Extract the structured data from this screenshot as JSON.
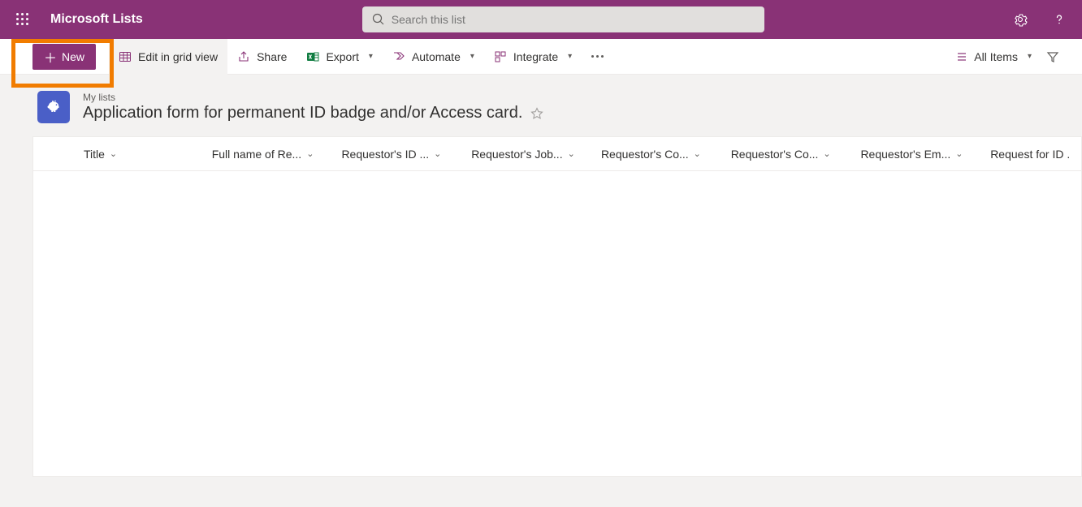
{
  "header": {
    "app_name": "Microsoft Lists",
    "search_placeholder": "Search this list"
  },
  "commandbar": {
    "new_label": "New",
    "edit_grid_label": "Edit in grid view",
    "share_label": "Share",
    "export_label": "Export",
    "automate_label": "Automate",
    "integrate_label": "Integrate",
    "view_label": "All Items"
  },
  "list": {
    "breadcrumb": "My lists",
    "title": "Application form for permanent ID badge and/or Access card."
  },
  "columns": [
    {
      "label": "Title"
    },
    {
      "label": "Full name of Re..."
    },
    {
      "label": "Requestor's ID ..."
    },
    {
      "label": "Requestor's Job..."
    },
    {
      "label": "Requestor's Co..."
    },
    {
      "label": "Requestor's Co..."
    },
    {
      "label": "Requestor's Em..."
    },
    {
      "label": "Request for ID ."
    }
  ]
}
